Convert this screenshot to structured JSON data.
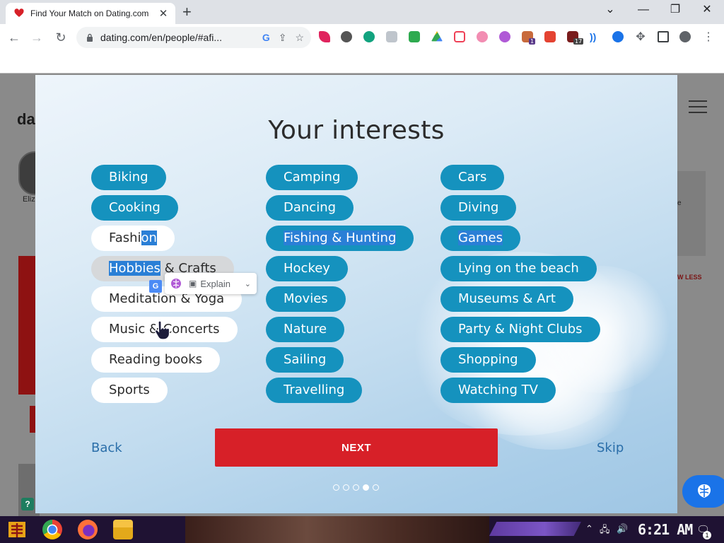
{
  "browser": {
    "tab_title": "Find Your Match on Dating.com",
    "new_tab_symbol": "+",
    "url": "dating.com/en/people/#afi...",
    "extension_badges": [
      "1",
      "17"
    ]
  },
  "background": {
    "logo_text": "da",
    "avatar_name": "Eliz",
    "right_text": "e",
    "right_less": "W LESS"
  },
  "modal": {
    "title": "Your interests",
    "columns": [
      [
        {
          "label": "Biking",
          "selected": true
        },
        {
          "label": "Cooking",
          "selected": true
        },
        {
          "label": "Fashion",
          "selected": false
        },
        {
          "label": "Hobbies & Crafts",
          "selected": false
        },
        {
          "label": "Meditation & Yoga",
          "selected": false
        },
        {
          "label": "Music & Concerts",
          "selected": false
        },
        {
          "label": "Reading books",
          "selected": false
        },
        {
          "label": "Sports",
          "selected": false
        }
      ],
      [
        {
          "label": "Camping",
          "selected": true
        },
        {
          "label": "Dancing",
          "selected": true
        },
        {
          "label": "Fishing & Hunting",
          "selected": true
        },
        {
          "label": "Hockey",
          "selected": true
        },
        {
          "label": "Movies",
          "selected": true
        },
        {
          "label": "Nature",
          "selected": true
        },
        {
          "label": "Sailing",
          "selected": true
        },
        {
          "label": "Travelling",
          "selected": true
        }
      ],
      [
        {
          "label": "Cars",
          "selected": true
        },
        {
          "label": "Diving",
          "selected": true
        },
        {
          "label": "Games",
          "selected": true
        },
        {
          "label": "Lying on the beach",
          "selected": true
        },
        {
          "label": "Museums & Art",
          "selected": true
        },
        {
          "label": "Party & Night Clubs",
          "selected": true
        },
        {
          "label": "Shopping",
          "selected": true
        },
        {
          "label": "Watching TV",
          "selected": true
        }
      ]
    ],
    "back_label": "Back",
    "next_label": "NEXT",
    "skip_label": "Skip",
    "progress": {
      "total_steps": 5,
      "current_step": 4
    }
  },
  "explain_popup": {
    "label": "Explain"
  },
  "taskbar": {
    "clock": "6:21 AM",
    "notification_count": "1"
  },
  "colors": {
    "pill_selected": "#1592be",
    "next_button": "#d72028",
    "link": "#2a6ea9",
    "selection_highlight": "#2a7fd6"
  }
}
